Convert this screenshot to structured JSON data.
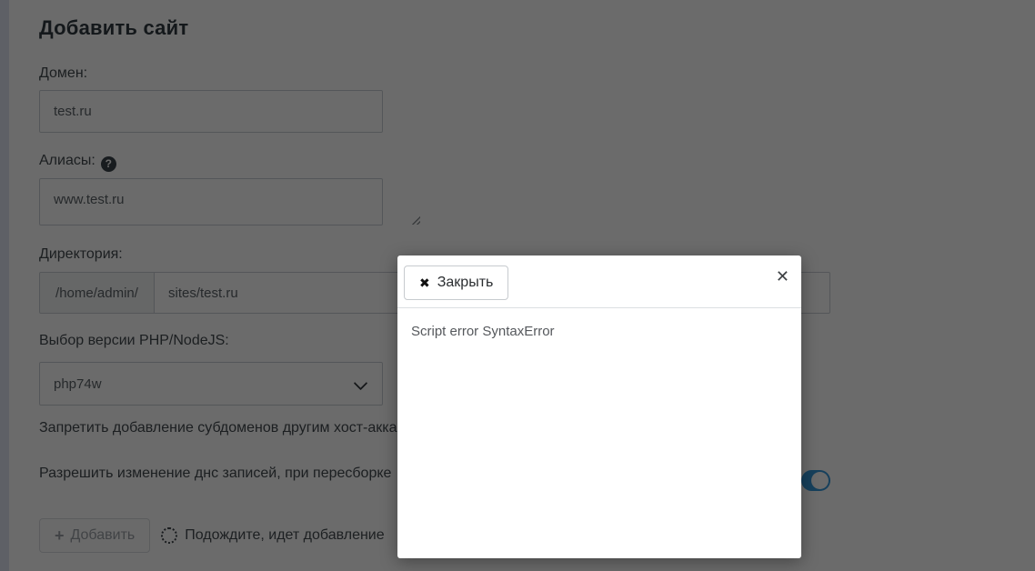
{
  "page": {
    "title": "Добавить сайт",
    "form": {
      "domain": {
        "label": "Домен:",
        "value": "test.ru"
      },
      "aliases": {
        "label": "Алиасы:",
        "value": "www.test.ru",
        "help_icon": "question-circle-icon"
      },
      "directory": {
        "label": "Директория:",
        "prefix": "/home/admin/",
        "value": "sites/test.ru"
      },
      "php": {
        "label": "Выбор версии PHP/NodeJS:",
        "selected": "php74w"
      },
      "toggle_subdomains": {
        "label": "Запретить добавление субдоменов другим хост-акка"
      },
      "toggle_dns": {
        "label": "Разрешить изменение днс записей, при пересборке",
        "state": "on"
      },
      "submit": {
        "label": "Добавить",
        "disabled": true
      },
      "progress": {
        "label": "Подождите, идет добавление"
      }
    }
  },
  "modal": {
    "close_button_label": "Закрыть",
    "body_text": "Script error SyntaxError"
  },
  "glyphs": {
    "question": "?",
    "plus": "+",
    "x_bold": "✖",
    "x_thin": "✕"
  },
  "colors": {
    "toggle_on": "#3598dc",
    "overlay": "rgba(0,0,0,0.58)"
  }
}
